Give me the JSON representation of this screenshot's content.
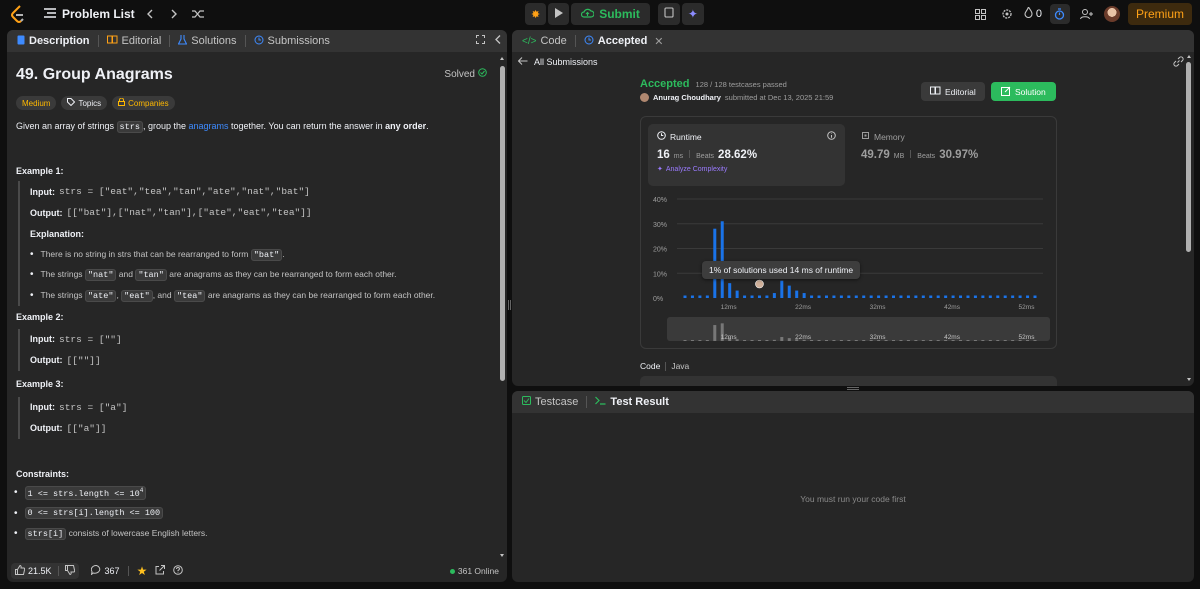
{
  "topbar": {
    "problem_list_label": "Problem List",
    "submit_label": "Submit",
    "streak_count": "0",
    "premium_label": "Premium"
  },
  "left_tabs": [
    {
      "label": "Description"
    },
    {
      "label": "Editorial"
    },
    {
      "label": "Solutions"
    },
    {
      "label": "Submissions"
    }
  ],
  "problem": {
    "title": "49. Group Anagrams",
    "solved_label": "Solved",
    "difficulty": "Medium",
    "topics_label": "Topics",
    "companies_label": "Companies",
    "desc_pre": "Given an array of strings ",
    "desc_code": "strs",
    "desc_mid": ", group the ",
    "desc_link": "anagrams",
    "desc_post": " together. You can return the answer in ",
    "desc_bold": "any order",
    "desc_end": ".",
    "input_label": "Input:",
    "output_label": "Output:",
    "ex1_title": "Example 1:",
    "ex1_input": "strs = [\"eat\",\"tea\",\"tan\",\"ate\",\"nat\",\"bat\"]",
    "ex1_output": "[[\"bat\"],[\"nat\",\"tan\"],[\"ate\",\"eat\",\"tea\"]]",
    "explanation_label": "Explanation:",
    "exp1_pre": "There is no string in strs that can be rearranged to form ",
    "exp1_code": "\"bat\"",
    "exp1_post": ".",
    "exp2_pre": "The strings ",
    "exp2_c1": "\"nat\"",
    "exp2_mid": " and ",
    "exp2_c2": "\"tan\"",
    "exp2_post": " are anagrams as they can be rearranged to form each other.",
    "exp3_pre": "The strings ",
    "exp3_c1": "\"ate\"",
    "exp3_sep1": ", ",
    "exp3_c2": "\"eat\"",
    "exp3_sep2": ", and ",
    "exp3_c3": "\"tea\"",
    "exp3_post": " are anagrams as they can be rearranged to form each other.",
    "ex2_title": "Example 2:",
    "ex2_input": "strs = [\"\"]",
    "ex2_output": "[[\"\"]]",
    "ex3_title": "Example 3:",
    "ex3_input": "strs = [\"a\"]",
    "ex3_output": "[[\"a\"]]",
    "constraints_label": "Constraints:",
    "c1_base": "1 <= strs.length <= 10",
    "c1_sup": "4",
    "c2": "0 <= strs[i].length <= 100",
    "c3_code": "strs[i]",
    "c3_post": " consists of lowercase English letters."
  },
  "footer": {
    "likes": "21.5K",
    "comments": "367",
    "online": "361 Online"
  },
  "right_tabs": [
    {
      "label": "Code"
    },
    {
      "label": "Accepted"
    }
  ],
  "submission": {
    "back_label": "All Submissions",
    "status": "Accepted",
    "testcases": "128 / 128 testcases passed",
    "author": "Anurag Choudhary",
    "submitted_at": "submitted at Dec 13, 2025 21:59",
    "editorial_label": "Editorial",
    "solution_label": "Solution",
    "runtime_label": "Runtime",
    "runtime_value": "16",
    "runtime_unit": "ms",
    "beats_label": "Beats",
    "runtime_beats": "28.62%",
    "analyze_label": "Analyze Complexity",
    "memory_label": "Memory",
    "memory_value": "49.79",
    "memory_unit": "MB",
    "memory_beats": "30.97%",
    "tooltip": "1% of solutions used 14 ms of runtime",
    "code_label": "Code",
    "lang": "Java"
  },
  "chart_data": {
    "type": "bar",
    "ylabel": "",
    "xlabel": "",
    "yticks": [
      "40%",
      "30%",
      "20%",
      "10%",
      "0%"
    ],
    "ylim": [
      0,
      40
    ],
    "xtick_labels": [
      "12ms",
      "22ms",
      "32ms",
      "42ms",
      "52ms"
    ],
    "x": [
      6,
      7,
      8,
      9,
      10,
      11,
      12,
      13,
      14,
      15,
      16,
      17,
      18,
      19,
      20,
      21,
      22,
      23,
      24,
      25,
      26,
      27,
      28,
      29,
      30,
      31,
      32,
      33,
      34,
      35,
      36,
      37,
      38,
      39,
      40,
      41,
      42,
      43,
      44,
      45,
      46,
      47,
      48,
      49,
      50,
      51,
      52,
      53
    ],
    "values": [
      1,
      1,
      1,
      1,
      28,
      31,
      6,
      3,
      1,
      1,
      1,
      1,
      2,
      7,
      5,
      3,
      2,
      1,
      1,
      1,
      1,
      1,
      1,
      1,
      1,
      1,
      1,
      1,
      1,
      1,
      1,
      1,
      1,
      1,
      1,
      1,
      1,
      1,
      1,
      1,
      1,
      1,
      1,
      1,
      1,
      1,
      1,
      1
    ],
    "highlight_x": 16,
    "minimap_xtick_labels": [
      "12ms",
      "22ms",
      "32ms",
      "42ms",
      "52ms"
    ]
  },
  "bottom_tabs": [
    {
      "label": "Testcase"
    },
    {
      "label": "Test Result"
    }
  ],
  "test_result": {
    "empty_message": "You must run your code first"
  },
  "colors": {
    "accent_green": "#2cbb5d",
    "bar_blue": "#1a73e8",
    "premium_orange": "#ffa116"
  }
}
